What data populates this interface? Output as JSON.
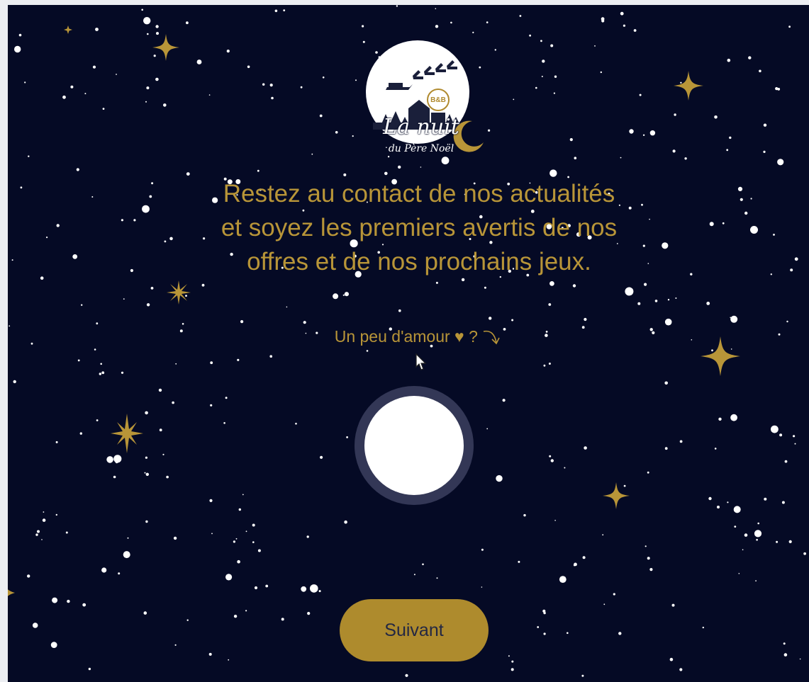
{
  "logo": {
    "title": "La nuit",
    "subtitle": "du Père Noël",
    "badge": "B&B"
  },
  "headline": "Restez au contact de nos actualités et soyez les premiers avertis de nos offres et de nos prochains jeux.",
  "love_prompt": "Un peu d'amour ♥ ?",
  "next_button": "Suivant",
  "colors": {
    "background": "#050a25",
    "gold": "#b89538",
    "button": "#ae8b2d",
    "moon_ring": "#333756",
    "moon": "#ffffff"
  },
  "icons": [
    "sparkle-star-icon",
    "crescent-moon-icon",
    "sleigh-icon",
    "curved-arrow-icon",
    "cursor-icon",
    "moon-heart-button"
  ]
}
